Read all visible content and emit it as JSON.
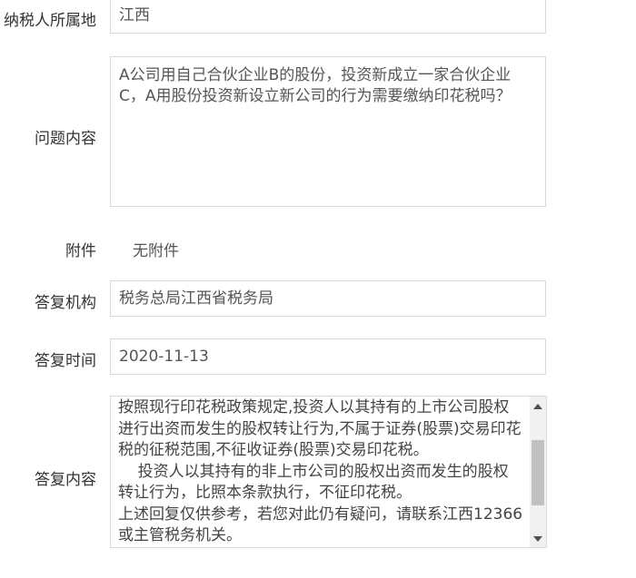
{
  "form": {
    "taxpayer_location": {
      "label": "纳税人所属地",
      "value": "江西"
    },
    "question": {
      "label": "问题内容",
      "value": "A公司用自己合伙企业B的股份，投资新成立一家合伙企业C，A用股份投资新设立新公司的行为需要缴纳印花税吗？"
    },
    "attachment": {
      "label": "附件",
      "value": "无附件"
    },
    "reply_org": {
      "label": "答复机构",
      "value": "税务总局江西省税务局"
    },
    "reply_time": {
      "label": "答复时间",
      "value": "2020-11-13"
    },
    "reply_content": {
      "label": "答复内容",
      "value": "按照现行印花税政策规定,投资人以其持有的上市公司股权进行出资而发生的股权转让行为,不属于证券(股票)交易印花税的征税范围,不征收证券(股票)交易印花税。\n    投资人以其持有的非上市公司的股权出资而发生的股权转让行为，比照本条款执行，不征印花税。\n上述回复仅供参考，若您对此仍有疑问，请联系江西12366或主管税务机关。"
    }
  },
  "icons": {
    "scroll_up": "scroll-up-arrow-icon",
    "scroll_down": "scroll-down-arrow-icon"
  },
  "colors": {
    "border": "#d9d9d9",
    "label": "#333333",
    "value": "#555555",
    "scrollbar_track": "#f1f1f1",
    "scrollbar_thumb": "#c1c1c1"
  }
}
